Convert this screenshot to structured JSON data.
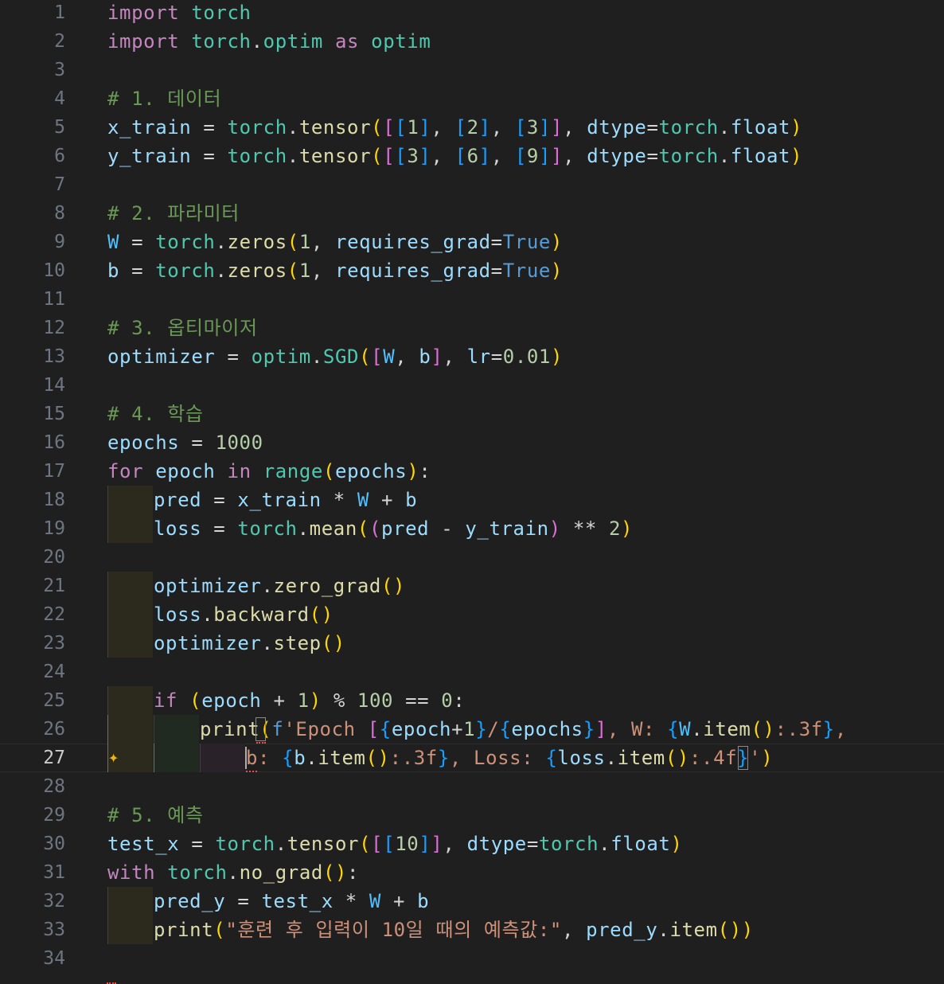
{
  "editor": {
    "theme": {
      "background": "#1f1f1f",
      "line_number": "#6e7681",
      "line_number_active": "#cccccc",
      "keyword": "#c586c0",
      "module": "#4ec9b0",
      "function": "#dcdcaa",
      "variable": "#9cdcfe",
      "const": "#4fc1ff",
      "number": "#b5cea8",
      "string": "#ce9178",
      "comment": "#6a9955",
      "operator": "#d4d4d4",
      "builtin_const": "#569cd6",
      "bracket1": "#ffd700",
      "bracket2": "#da70d6",
      "bracket3": "#179fff",
      "error": "#f14c4c"
    },
    "active_line": 27,
    "icons": {
      "gutter": "sparkle-icon"
    },
    "lines": [
      {
        "n": "1",
        "indent": 0,
        "tokens": [
          [
            "kw",
            "import"
          ],
          [
            "op",
            " "
          ],
          [
            "mod",
            "torch"
          ]
        ]
      },
      {
        "n": "2",
        "indent": 0,
        "tokens": [
          [
            "kw",
            "import"
          ],
          [
            "op",
            " "
          ],
          [
            "mod",
            "torch"
          ],
          [
            "op",
            "."
          ],
          [
            "mod",
            "optim"
          ],
          [
            "op",
            " "
          ],
          [
            "kw",
            "as"
          ],
          [
            "op",
            " "
          ],
          [
            "mod",
            "optim"
          ]
        ]
      },
      {
        "n": "3",
        "indent": 0,
        "tokens": []
      },
      {
        "n": "4",
        "indent": 0,
        "tokens": [
          [
            "cm",
            "# 1. 데이터"
          ]
        ]
      },
      {
        "n": "5",
        "indent": 0,
        "tokens": [
          [
            "var",
            "x_train"
          ],
          [
            "op",
            " = "
          ],
          [
            "mod",
            "torch"
          ],
          [
            "op",
            "."
          ],
          [
            "fn",
            "tensor"
          ],
          [
            "b1",
            "("
          ],
          [
            "b2",
            "["
          ],
          [
            "b3",
            "["
          ],
          [
            "num",
            "1"
          ],
          [
            "b3",
            "]"
          ],
          [
            "op",
            ", "
          ],
          [
            "b3",
            "["
          ],
          [
            "num",
            "2"
          ],
          [
            "b3",
            "]"
          ],
          [
            "op",
            ", "
          ],
          [
            "b3",
            "["
          ],
          [
            "num",
            "3"
          ],
          [
            "b3",
            "]"
          ],
          [
            "b2",
            "]"
          ],
          [
            "op",
            ", "
          ],
          [
            "var",
            "dtype"
          ],
          [
            "op",
            "="
          ],
          [
            "mod",
            "torch"
          ],
          [
            "op",
            "."
          ],
          [
            "var",
            "float"
          ],
          [
            "b1",
            ")"
          ]
        ]
      },
      {
        "n": "6",
        "indent": 0,
        "tokens": [
          [
            "var",
            "y_train"
          ],
          [
            "op",
            " = "
          ],
          [
            "mod",
            "torch"
          ],
          [
            "op",
            "."
          ],
          [
            "fn",
            "tensor"
          ],
          [
            "b1",
            "("
          ],
          [
            "b2",
            "["
          ],
          [
            "b3",
            "["
          ],
          [
            "num",
            "3"
          ],
          [
            "b3",
            "]"
          ],
          [
            "op",
            ", "
          ],
          [
            "b3",
            "["
          ],
          [
            "num",
            "6"
          ],
          [
            "b3",
            "]"
          ],
          [
            "op",
            ", "
          ],
          [
            "b3",
            "["
          ],
          [
            "num",
            "9"
          ],
          [
            "b3",
            "]"
          ],
          [
            "b2",
            "]"
          ],
          [
            "op",
            ", "
          ],
          [
            "var",
            "dtype"
          ],
          [
            "op",
            "="
          ],
          [
            "mod",
            "torch"
          ],
          [
            "op",
            "."
          ],
          [
            "var",
            "float"
          ],
          [
            "b1",
            ")"
          ]
        ]
      },
      {
        "n": "7",
        "indent": 0,
        "tokens": []
      },
      {
        "n": "8",
        "indent": 0,
        "tokens": [
          [
            "cm",
            "# 2. 파라미터"
          ]
        ]
      },
      {
        "n": "9",
        "indent": 0,
        "tokens": [
          [
            "const",
            "W"
          ],
          [
            "op",
            " = "
          ],
          [
            "mod",
            "torch"
          ],
          [
            "op",
            "."
          ],
          [
            "fn",
            "zeros"
          ],
          [
            "b1",
            "("
          ],
          [
            "num",
            "1"
          ],
          [
            "op",
            ", "
          ],
          [
            "var",
            "requires_grad"
          ],
          [
            "op",
            "="
          ],
          [
            "bconst",
            "True"
          ],
          [
            "b1",
            ")"
          ]
        ]
      },
      {
        "n": "10",
        "indent": 0,
        "tokens": [
          [
            "var",
            "b"
          ],
          [
            "op",
            " = "
          ],
          [
            "mod",
            "torch"
          ],
          [
            "op",
            "."
          ],
          [
            "fn",
            "zeros"
          ],
          [
            "b1",
            "("
          ],
          [
            "num",
            "1"
          ],
          [
            "op",
            ", "
          ],
          [
            "var",
            "requires_grad"
          ],
          [
            "op",
            "="
          ],
          [
            "bconst",
            "True"
          ],
          [
            "b1",
            ")"
          ]
        ]
      },
      {
        "n": "11",
        "indent": 0,
        "tokens": []
      },
      {
        "n": "12",
        "indent": 0,
        "tokens": [
          [
            "cm",
            "# 3. 옵티마이저"
          ]
        ]
      },
      {
        "n": "13",
        "indent": 0,
        "tokens": [
          [
            "var",
            "optimizer"
          ],
          [
            "op",
            " = "
          ],
          [
            "mod",
            "optim"
          ],
          [
            "op",
            "."
          ],
          [
            "mod",
            "SGD"
          ],
          [
            "b1",
            "("
          ],
          [
            "b2",
            "["
          ],
          [
            "const",
            "W"
          ],
          [
            "op",
            ", "
          ],
          [
            "var",
            "b"
          ],
          [
            "b2",
            "]"
          ],
          [
            "op",
            ", "
          ],
          [
            "var",
            "lr"
          ],
          [
            "op",
            "="
          ],
          [
            "num",
            "0.01"
          ],
          [
            "b1",
            ")"
          ]
        ]
      },
      {
        "n": "14",
        "indent": 0,
        "tokens": []
      },
      {
        "n": "15",
        "indent": 0,
        "tokens": [
          [
            "cm",
            "# 4. 학습"
          ]
        ]
      },
      {
        "n": "16",
        "indent": 0,
        "tokens": [
          [
            "var",
            "epochs"
          ],
          [
            "op",
            " = "
          ],
          [
            "num",
            "1000"
          ]
        ]
      },
      {
        "n": "17",
        "indent": 0,
        "tokens": [
          [
            "kw",
            "for"
          ],
          [
            "op",
            " "
          ],
          [
            "var",
            "epoch"
          ],
          [
            "op",
            " "
          ],
          [
            "kw",
            "in"
          ],
          [
            "op",
            " "
          ],
          [
            "mod",
            "range"
          ],
          [
            "b1",
            "("
          ],
          [
            "var",
            "epochs"
          ],
          [
            "b1",
            ")"
          ],
          [
            "op",
            ":"
          ]
        ]
      },
      {
        "n": "18",
        "indent": 1,
        "tokens": [
          [
            "var",
            "pred"
          ],
          [
            "op",
            " = "
          ],
          [
            "var",
            "x_train"
          ],
          [
            "op",
            " * "
          ],
          [
            "const",
            "W"
          ],
          [
            "op",
            " + "
          ],
          [
            "var",
            "b"
          ]
        ]
      },
      {
        "n": "19",
        "indent": 1,
        "tokens": [
          [
            "var",
            "loss"
          ],
          [
            "op",
            " = "
          ],
          [
            "mod",
            "torch"
          ],
          [
            "op",
            "."
          ],
          [
            "fn",
            "mean"
          ],
          [
            "b1",
            "("
          ],
          [
            "b2",
            "("
          ],
          [
            "var",
            "pred"
          ],
          [
            "op",
            " - "
          ],
          [
            "var",
            "y_train"
          ],
          [
            "b2",
            ")"
          ],
          [
            "op",
            " ** "
          ],
          [
            "num",
            "2"
          ],
          [
            "b1",
            ")"
          ]
        ]
      },
      {
        "n": "20",
        "indent": 0,
        "tokens": []
      },
      {
        "n": "21",
        "indent": 1,
        "tokens": [
          [
            "var",
            "optimizer"
          ],
          [
            "op",
            "."
          ],
          [
            "fn",
            "zero_grad"
          ],
          [
            "b1",
            "()"
          ]
        ]
      },
      {
        "n": "22",
        "indent": 1,
        "tokens": [
          [
            "var",
            "loss"
          ],
          [
            "op",
            "."
          ],
          [
            "fn",
            "backward"
          ],
          [
            "b1",
            "()"
          ]
        ]
      },
      {
        "n": "23",
        "indent": 1,
        "tokens": [
          [
            "var",
            "optimizer"
          ],
          [
            "op",
            "."
          ],
          [
            "fn",
            "step"
          ],
          [
            "b1",
            "()"
          ]
        ]
      },
      {
        "n": "24",
        "indent": 0,
        "tokens": []
      },
      {
        "n": "25",
        "indent": 1,
        "tokens": [
          [
            "kw",
            "if"
          ],
          [
            "op",
            " "
          ],
          [
            "b1",
            "("
          ],
          [
            "var",
            "epoch"
          ],
          [
            "op",
            " + "
          ],
          [
            "num",
            "1"
          ],
          [
            "b1",
            ")"
          ],
          [
            "op",
            " % "
          ],
          [
            "num",
            "100"
          ],
          [
            "op",
            " == "
          ],
          [
            "num",
            "0"
          ],
          [
            "op",
            ":"
          ]
        ]
      },
      {
        "n": "26",
        "indent": 2,
        "tokens": [
          [
            "fn",
            "print"
          ],
          [
            "b1",
            "("
          ],
          [
            "bconst",
            "f"
          ],
          [
            "str",
            "'Epoch "
          ],
          [
            "b2",
            "["
          ],
          [
            "b3",
            "{"
          ],
          [
            "var",
            "epoch"
          ],
          [
            "op",
            "+"
          ],
          [
            "num",
            "1"
          ],
          [
            "b3",
            "}"
          ],
          [
            "str",
            "/"
          ],
          [
            "b3",
            "{"
          ],
          [
            "var",
            "epochs"
          ],
          [
            "b3",
            "}"
          ],
          [
            "b2",
            "]"
          ],
          [
            "str",
            ", W: "
          ],
          [
            "b3",
            "{"
          ],
          [
            "const",
            "W"
          ],
          [
            "op",
            "."
          ],
          [
            "fn",
            "item"
          ],
          [
            "b1",
            "()"
          ],
          [
            "str",
            ":.3f"
          ],
          [
            "b3",
            "}"
          ],
          [
            "str",
            ","
          ]
        ]
      },
      {
        "n": "27",
        "indent": 3,
        "tokens": [
          [
            "str",
            "b: "
          ],
          [
            "b3",
            "{"
          ],
          [
            "var",
            "b"
          ],
          [
            "op",
            "."
          ],
          [
            "fn",
            "item"
          ],
          [
            "b1",
            "()"
          ],
          [
            "str",
            ":.3f"
          ],
          [
            "b3",
            "}"
          ],
          [
            "str",
            ", Loss: "
          ],
          [
            "b3",
            "{"
          ],
          [
            "var",
            "loss"
          ],
          [
            "op",
            "."
          ],
          [
            "fn",
            "item"
          ],
          [
            "b1",
            "()"
          ],
          [
            "str",
            ":.4f"
          ],
          [
            "b3",
            "}"
          ],
          [
            "str",
            "'"
          ],
          [
            "b1",
            ")"
          ]
        ]
      },
      {
        "n": "28",
        "indent": 0,
        "tokens": []
      },
      {
        "n": "29",
        "indent": 0,
        "tokens": [
          [
            "cm",
            "# 5. 예측"
          ]
        ]
      },
      {
        "n": "30",
        "indent": 0,
        "tokens": [
          [
            "var",
            "test_x"
          ],
          [
            "op",
            " = "
          ],
          [
            "mod",
            "torch"
          ],
          [
            "op",
            "."
          ],
          [
            "fn",
            "tensor"
          ],
          [
            "b1",
            "("
          ],
          [
            "b2",
            "["
          ],
          [
            "b3",
            "["
          ],
          [
            "num",
            "10"
          ],
          [
            "b3",
            "]"
          ],
          [
            "b2",
            "]"
          ],
          [
            "op",
            ", "
          ],
          [
            "var",
            "dtype"
          ],
          [
            "op",
            "="
          ],
          [
            "mod",
            "torch"
          ],
          [
            "op",
            "."
          ],
          [
            "var",
            "float"
          ],
          [
            "b1",
            ")"
          ]
        ]
      },
      {
        "n": "31",
        "indent": 0,
        "tokens": [
          [
            "kw",
            "with"
          ],
          [
            "op",
            " "
          ],
          [
            "mod",
            "torch"
          ],
          [
            "op",
            "."
          ],
          [
            "fn",
            "no_grad"
          ],
          [
            "b1",
            "()"
          ],
          [
            "op",
            ":"
          ]
        ]
      },
      {
        "n": "32",
        "indent": 1,
        "tokens": [
          [
            "var",
            "pred_y"
          ],
          [
            "op",
            " = "
          ],
          [
            "var",
            "test_x"
          ],
          [
            "op",
            " * "
          ],
          [
            "const",
            "W"
          ],
          [
            "op",
            " + "
          ],
          [
            "var",
            "b"
          ]
        ]
      },
      {
        "n": "33",
        "indent": 1,
        "tokens": [
          [
            "fn",
            "print"
          ],
          [
            "b1",
            "("
          ],
          [
            "str",
            "\"훈련 후 입력이 10일 때의 예측값:\""
          ],
          [
            "op",
            ", "
          ],
          [
            "var",
            "pred_y"
          ],
          [
            "op",
            "."
          ],
          [
            "fn",
            "item"
          ],
          [
            "b1",
            "()"
          ],
          [
            "b1",
            ")"
          ]
        ]
      },
      {
        "n": "34",
        "indent": 0,
        "tokens": []
      }
    ]
  }
}
